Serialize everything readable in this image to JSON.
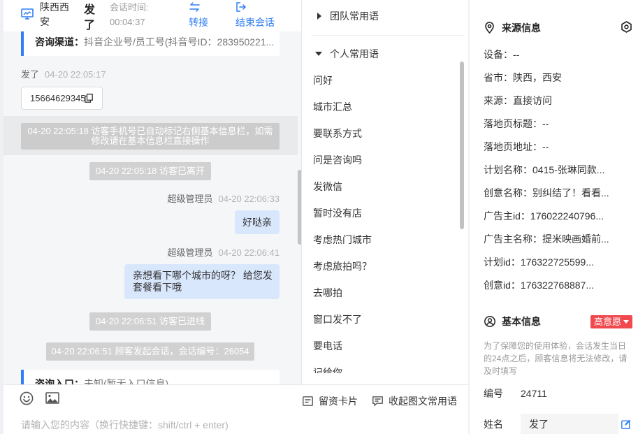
{
  "colors": {
    "accent": "#2f7ef5",
    "chat_background": "#f5f6f8",
    "agent_bubble": "#d9e7fd",
    "system_pill": "#d1d1d1",
    "intent_badge": "#f04a4f"
  },
  "icons": {
    "header_monitor": "monitor-icon",
    "transfer": "transfer-icon",
    "end_session": "logout-icon",
    "copy": "copy-icon",
    "group_collapsed": "caret-right-icon",
    "group_expanded": "caret-down-icon",
    "emoji": "smiley-icon",
    "image": "image-icon",
    "lead_card": "card-icon",
    "phrases": "message-icon",
    "source_info": "location-pin-icon",
    "settings": "settings-icon",
    "basic_info": "user-circle-icon",
    "badge_dropdown": "caret-down-icon",
    "name_edit": "edit-icon"
  },
  "header": {
    "location": "陕西西安",
    "visitor_name": "发了",
    "session_time_label": "会话时间:",
    "session_time": "00:04:37",
    "transfer_label": "转接",
    "end_session_label": "结束会话"
  },
  "messages": {
    "channel_card": {
      "label": "咨询渠道：",
      "value": "抖音企业号/员工号(抖音号ID：283950221..."
    },
    "visitor_message": {
      "sender": "发了",
      "time": "04-20 22:05:17",
      "text": "15664629345"
    },
    "phone_tagged_notice": {
      "time": "04-20 22:05:18",
      "text": "访客手机号已自动标记右侧基本信息栏，如需修改请在基本信息栏直接操作"
    },
    "visitor_left": {
      "time": "04-20 22:05:18",
      "text": "访客已离开"
    },
    "agent_messages": [
      {
        "sender": "超级管理员",
        "time": "04-20 22:06:33",
        "text": "好哒亲"
      },
      {
        "sender": "超级管理员",
        "time": "04-20 22:06:41",
        "text": "亲想看下哪个城市的呀？ 给您发套餐看下哦"
      }
    ],
    "visitor_joined": {
      "time": "04-20 22:06:51",
      "text": "访客已进线"
    },
    "session_started": {
      "time": "04-20 22:06:51",
      "text": "顾客发起会话，会话编号：26054"
    },
    "entry_card": {
      "label": "咨询入口：",
      "value": "未知(暂无入口信息)"
    }
  },
  "quick_phrases": {
    "team_label": "团队常用语",
    "team_expanded": false,
    "personal_label": "个人常用语",
    "personal_expanded": true,
    "personal_items": [
      "问好",
      "城市汇总",
      "要联系方式",
      "问是咨询吗",
      "发微信",
      "暂时没有店",
      "考虑热门城市",
      "考虑旅拍吗？",
      "去哪拍",
      "窗口发不了",
      "要电话",
      "记给你"
    ]
  },
  "composer": {
    "lead_card_label": "留资卡片",
    "collapse_phrases_label": "收起图文常用语",
    "placeholder": "请输入您的内容（换行快捷键：shift/ctrl + enter)"
  },
  "source_info": {
    "title": "来源信息",
    "fields": [
      {
        "label": "设备：",
        "value": "--"
      },
      {
        "label": "省市：",
        "value": "陕西，西安"
      },
      {
        "label": "来源：",
        "value": "直接访问"
      },
      {
        "label": "落地页标题：",
        "value": "--"
      },
      {
        "label": "落地页地址：",
        "value": "--"
      },
      {
        "label": "计划名称：",
        "value": "0415-张琳同款..."
      },
      {
        "label": "创意名称：",
        "value": "别纠结了！看看..."
      },
      {
        "label": "广告主id：",
        "value": "176022240796..."
      },
      {
        "label": "广告主名称：",
        "value": "提米映画婚前..."
      },
      {
        "label": "计划id：",
        "value": "176322725599..."
      },
      {
        "label": "创意id：",
        "value": "176322768887..."
      }
    ]
  },
  "basic_info": {
    "title": "基本信息",
    "intent_badge": "高意愿",
    "notice": "为了保障您的使用体验，会话发生当日的24点之后，顾客信息将无法修改，请及时填写",
    "id_label": "编号",
    "id_value": "24711",
    "name_label": "姓名",
    "name_value": "发了"
  }
}
